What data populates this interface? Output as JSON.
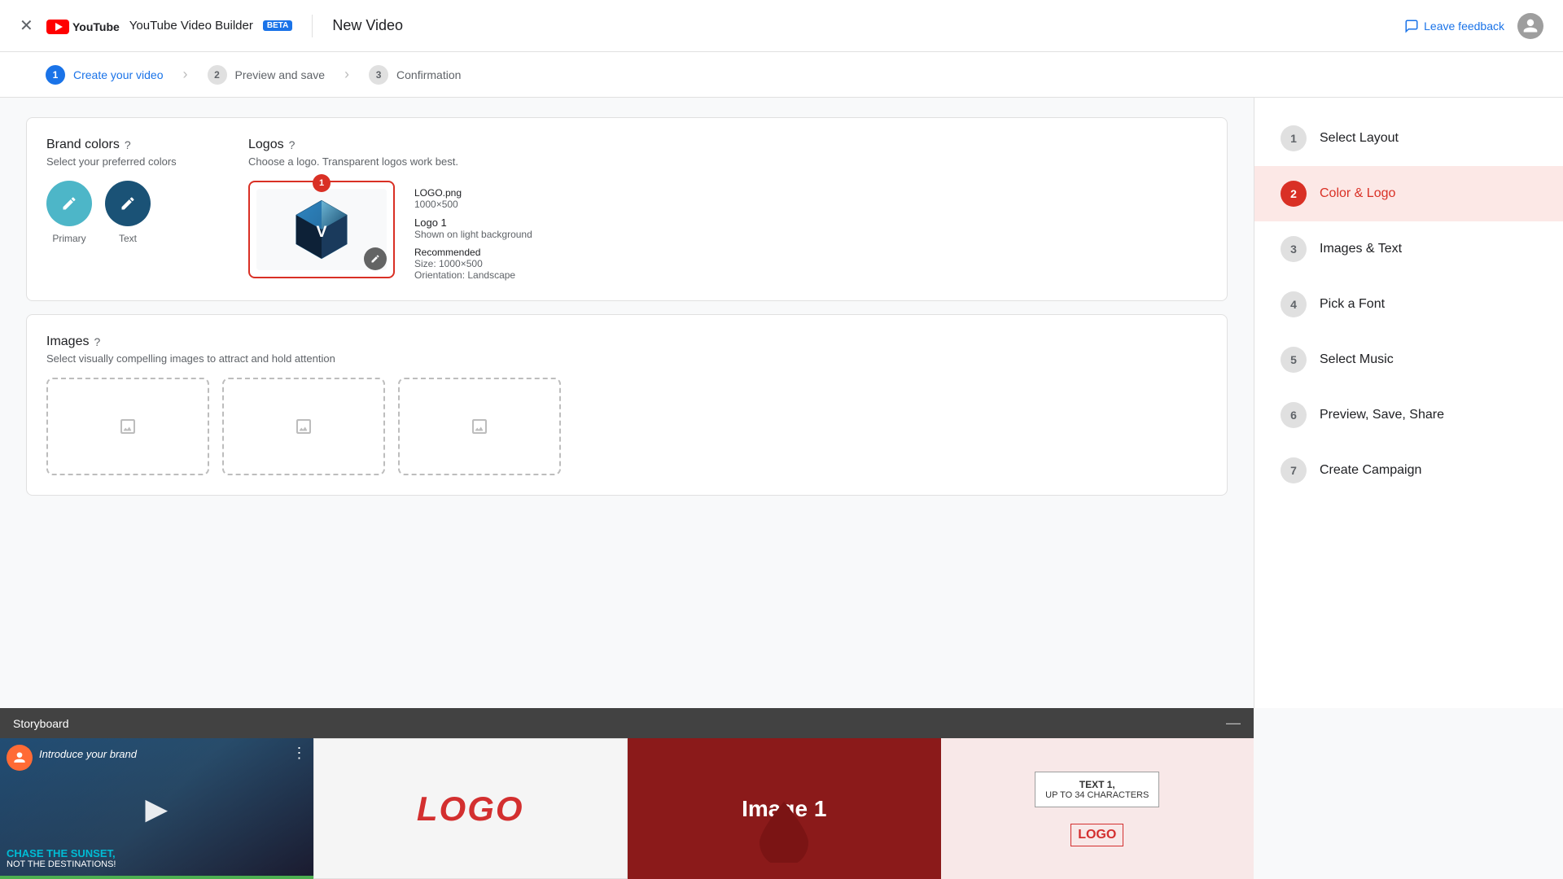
{
  "header": {
    "app_name": "YouTube Video Builder",
    "beta_label": "BETA",
    "title": "New Video",
    "feedback_label": "Leave feedback",
    "close_icon": "✕"
  },
  "steps_bar": {
    "steps": [
      {
        "num": "1",
        "label": "Create your video",
        "state": "active"
      },
      {
        "num": "2",
        "label": "Preview and save",
        "state": "inactive"
      },
      {
        "num": "3",
        "label": "Confirmation",
        "state": "inactive"
      }
    ]
  },
  "brand_colors": {
    "title": "Brand colors",
    "subtitle": "Select your preferred colors",
    "primary_label": "Primary",
    "text_label": "Text"
  },
  "logos": {
    "title": "Logos",
    "subtitle": "Choose a logo. Transparent logos work best.",
    "badge_count": "1",
    "filename": "LOGO.png",
    "dimensions": "1000×500",
    "label_num": "Logo 1",
    "background_hint": "Shown on light background",
    "recommended_title": "Recommended",
    "size_label": "Size: 1000×500",
    "orientation_label": "Orientation: Landscape"
  },
  "images": {
    "title": "Images",
    "subtitle": "Select visually compelling images to attract and hold attention"
  },
  "sidebar": {
    "items": [
      {
        "num": "1",
        "label": "Select Layout",
        "state": "inactive"
      },
      {
        "num": "2",
        "label": "Color & Logo",
        "state": "active"
      },
      {
        "num": "3",
        "label": "Images & Text",
        "state": "inactive"
      },
      {
        "num": "4",
        "label": "Pick a Font",
        "state": "inactive"
      },
      {
        "num": "5",
        "label": "Select Music",
        "state": "inactive"
      },
      {
        "num": "6",
        "label": "Preview, Save, Share",
        "state": "inactive"
      },
      {
        "num": "7",
        "label": "Create Campaign",
        "state": "inactive"
      }
    ]
  },
  "storyboard": {
    "title": "Storyboard",
    "minimize_icon": "—",
    "frames": [
      {
        "type": "video",
        "intro_label": "Introduce your brand",
        "text_line1": "CHASE THE SUNSET,",
        "text_line2": "NOT THE DESTINATIONS!"
      },
      {
        "type": "logo",
        "logo_text": "LOGO"
      },
      {
        "type": "image",
        "image_label": "Image 1"
      },
      {
        "type": "text",
        "text_line1": "TEXT 1,",
        "text_line2": "UP TO 34 CHARACTERS",
        "logo_text": "LOGO"
      }
    ]
  }
}
